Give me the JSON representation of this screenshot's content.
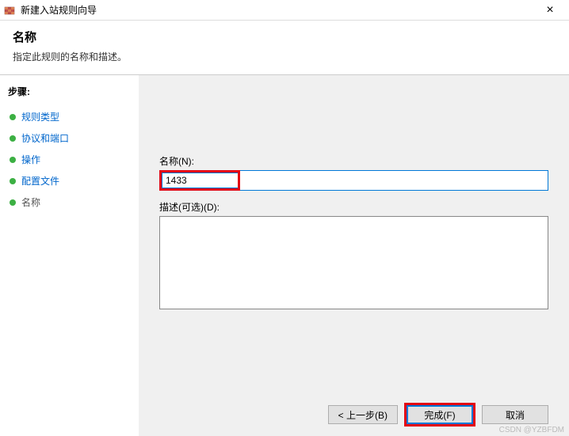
{
  "window": {
    "title": "新建入站规则向导",
    "close": "×"
  },
  "header": {
    "title": "名称",
    "subtitle": "指定此规则的名称和描述。"
  },
  "sidebar": {
    "heading": "步骤:",
    "items": [
      {
        "label": "规则类型",
        "state": "done"
      },
      {
        "label": "协议和端口",
        "state": "done"
      },
      {
        "label": "操作",
        "state": "done"
      },
      {
        "label": "配置文件",
        "state": "done"
      },
      {
        "label": "名称",
        "state": "current"
      }
    ]
  },
  "form": {
    "name_label": "名称(N):",
    "name_value": "1433",
    "desc_label": "描述(可选)(D):",
    "desc_value": ""
  },
  "buttons": {
    "back": "< 上一步(B)",
    "finish": "完成(F)",
    "cancel": "取消"
  },
  "watermark": "CSDN @YZBFDM"
}
